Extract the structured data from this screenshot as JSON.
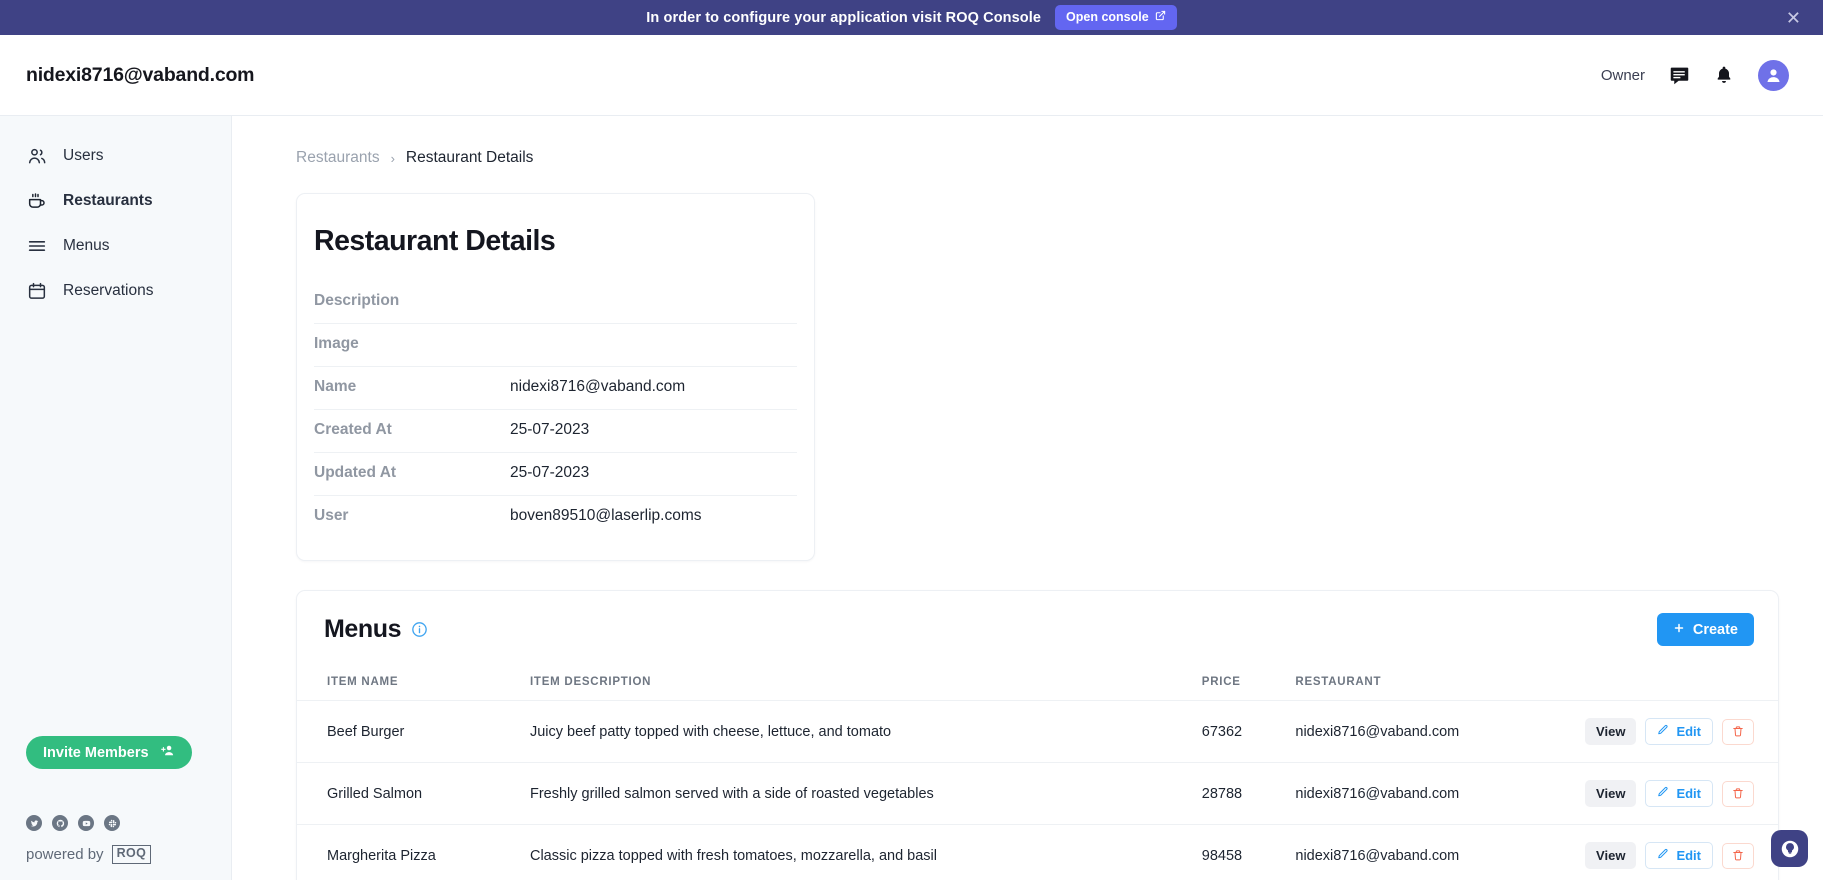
{
  "banner": {
    "message": "In order to configure your application visit ROQ Console",
    "button_label": "Open console",
    "close_label": "✕",
    "bg_color": "#3f4285",
    "button_color": "#6366f1"
  },
  "header": {
    "brand": "nidexi8716@vaband.com",
    "role": "Owner",
    "icons": [
      "chat-icon",
      "bell-icon",
      "avatar"
    ]
  },
  "sidebar": {
    "items": [
      {
        "label": "Users",
        "icon": "users-icon",
        "active": false
      },
      {
        "label": "Restaurants",
        "icon": "coffee-cup-icon",
        "active": true
      },
      {
        "label": "Menus",
        "icon": "menu-lines-icon",
        "active": false
      },
      {
        "label": "Reservations",
        "icon": "calendar-icon",
        "active": false
      }
    ],
    "invite_label": "Invite Members",
    "invite_color": "#32bd80",
    "socials": [
      "twitter-icon",
      "github-icon",
      "youtube-icon",
      "slack-icon"
    ],
    "powered_text": "powered by",
    "powered_logo": "ROQ"
  },
  "breadcrumb": {
    "parent": "Restaurants",
    "separator": "›",
    "current": "Restaurant Details"
  },
  "details": {
    "title": "Restaurant Details",
    "rows": [
      {
        "label": "Description",
        "value": ""
      },
      {
        "label": "Image",
        "value": ""
      },
      {
        "label": "Name",
        "value": "nidexi8716@vaband.com"
      },
      {
        "label": "Created At",
        "value": "25-07-2023"
      },
      {
        "label": "Updated At",
        "value": "25-07-2023"
      },
      {
        "label": "User",
        "value": "boven89510@laserlip.coms"
      }
    ]
  },
  "menus": {
    "title": "Menus",
    "info_icon": "info-circle-icon",
    "create_label": "Create",
    "create_icon": "plus-icon",
    "create_color": "#2196f3",
    "columns": [
      "ITEM NAME",
      "ITEM DESCRIPTION",
      "PRICE",
      "RESTAURANT"
    ],
    "row_actions": {
      "view": "View",
      "edit": "Edit",
      "delete": "delete-icon"
    },
    "rows": [
      {
        "name": "Beef Burger",
        "description": "Juicy beef patty topped with cheese, lettuce, and tomato",
        "price": "67362",
        "restaurant": "nidexi8716@vaband.com"
      },
      {
        "name": "Grilled Salmon",
        "description": "Freshly grilled salmon served with a side of roasted vegetables",
        "price": "28788",
        "restaurant": "nidexi8716@vaband.com"
      },
      {
        "name": "Margherita Pizza",
        "description": "Classic pizza topped with fresh tomatoes, mozzarella, and basil",
        "price": "98458",
        "restaurant": "nidexi8716@vaband.com"
      }
    ]
  },
  "support": {
    "icon": "support-widget-icon",
    "color": "#3f4285"
  }
}
